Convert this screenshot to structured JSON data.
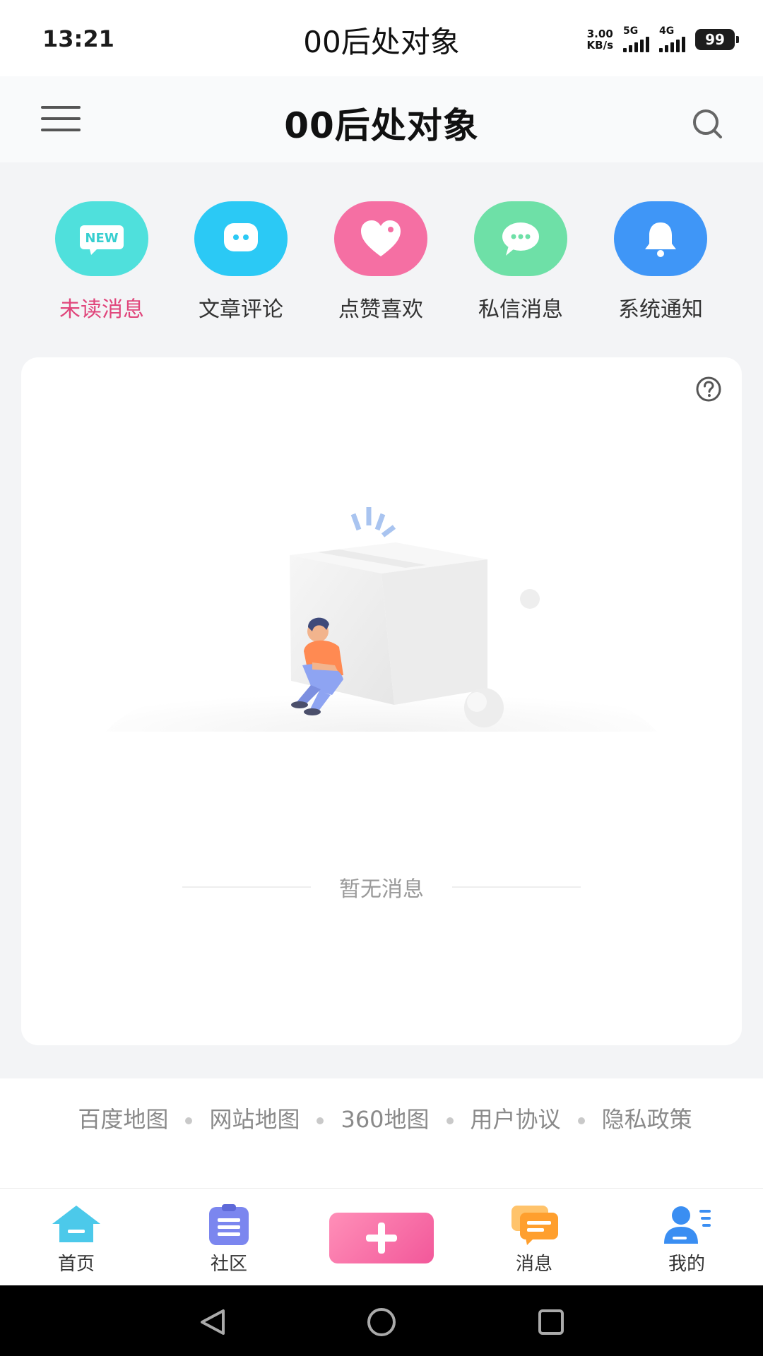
{
  "status_bar": {
    "time": "13:21",
    "title": "00后处对象",
    "net_speed_value": "3.00",
    "net_speed_unit": "KB/s",
    "signal_1_label": "5G",
    "signal_2_label": "4G",
    "battery": "99"
  },
  "header": {
    "title": "00后处对象",
    "menu_icon": "hamburger-menu-icon",
    "search_icon": "search-icon"
  },
  "categories": [
    {
      "label": "未读消息",
      "icon": "new-badge-icon",
      "color": "#4fe0dc",
      "active": true
    },
    {
      "label": "文章评论",
      "icon": "chat-bubble-icon",
      "color": "#2bc9f5",
      "active": false
    },
    {
      "label": "点赞喜欢",
      "icon": "heart-icon",
      "color": "#f56fa3",
      "active": false
    },
    {
      "label": "私信消息",
      "icon": "message-dots-icon",
      "color": "#6ee0a7",
      "active": false
    },
    {
      "label": "系统通知",
      "icon": "bell-icon",
      "color": "#3f96f7",
      "active": false
    }
  ],
  "empty_state": {
    "text": "暂无消息",
    "help_icon": "help-circle-icon"
  },
  "footer_links": {
    "items": [
      "百度地图",
      "网站地图",
      "360地图",
      "用户协议",
      "隐私政策"
    ]
  },
  "tabbar": {
    "tabs": [
      {
        "label": "首页",
        "icon": "home-icon"
      },
      {
        "label": "社区",
        "icon": "community-list-icon"
      },
      {
        "label": "消息",
        "icon": "message-icon"
      },
      {
        "label": "我的",
        "icon": "profile-icon"
      }
    ],
    "post_icon": "plus-icon"
  },
  "colors": {
    "accent_pink": "#e0457b",
    "page_bg": "#f3f4f6"
  }
}
